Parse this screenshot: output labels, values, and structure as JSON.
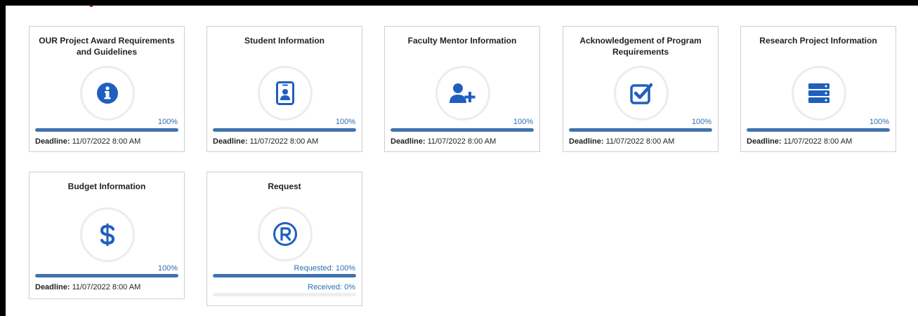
{
  "colors": {
    "icon_blue": "#1f5fbf",
    "progress_blue": "#3f73ad",
    "progress_text": "#2f6db3"
  },
  "tiles": [
    {
      "title": "OUR Project Award Requirements and Guidelines",
      "icon": "info-icon",
      "progress_label": "100%",
      "progress": 1.0,
      "deadline_label": "Deadline:",
      "deadline_value": "11/07/2022 8:00 AM"
    },
    {
      "title": "Student Information",
      "icon": "id-badge-icon",
      "progress_label": "100%",
      "progress": 1.0,
      "deadline_label": "Deadline:",
      "deadline_value": "11/07/2022 8:00 AM"
    },
    {
      "title": "Faculty Mentor Information",
      "icon": "user-plus-icon",
      "progress_label": "100%",
      "progress": 1.0,
      "deadline_label": "Deadline:",
      "deadline_value": "11/07/2022 8:00 AM"
    },
    {
      "title": "Acknowledgement of Program Requirements",
      "icon": "checkbox-icon",
      "progress_label": "100%",
      "progress": 1.0,
      "deadline_label": "Deadline:",
      "deadline_value": "11/07/2022 8:00 AM"
    },
    {
      "title": "Research Project Information",
      "icon": "server-icon",
      "progress_label": "100%",
      "progress": 1.0,
      "deadline_label": "Deadline:",
      "deadline_value": "11/07/2022 8:00 AM"
    },
    {
      "title": "Budget Information",
      "icon": "dollar-icon",
      "progress_label": "100%",
      "progress": 1.0,
      "deadline_label": "Deadline:",
      "deadline_value": "11/07/2022 8:00 AM"
    },
    {
      "title": "Request",
      "icon": "registered-icon",
      "requested_label": "Requested: 100%",
      "requested_progress": 1.0,
      "received_label": "Received: 0%",
      "received_progress": 0.0
    }
  ]
}
